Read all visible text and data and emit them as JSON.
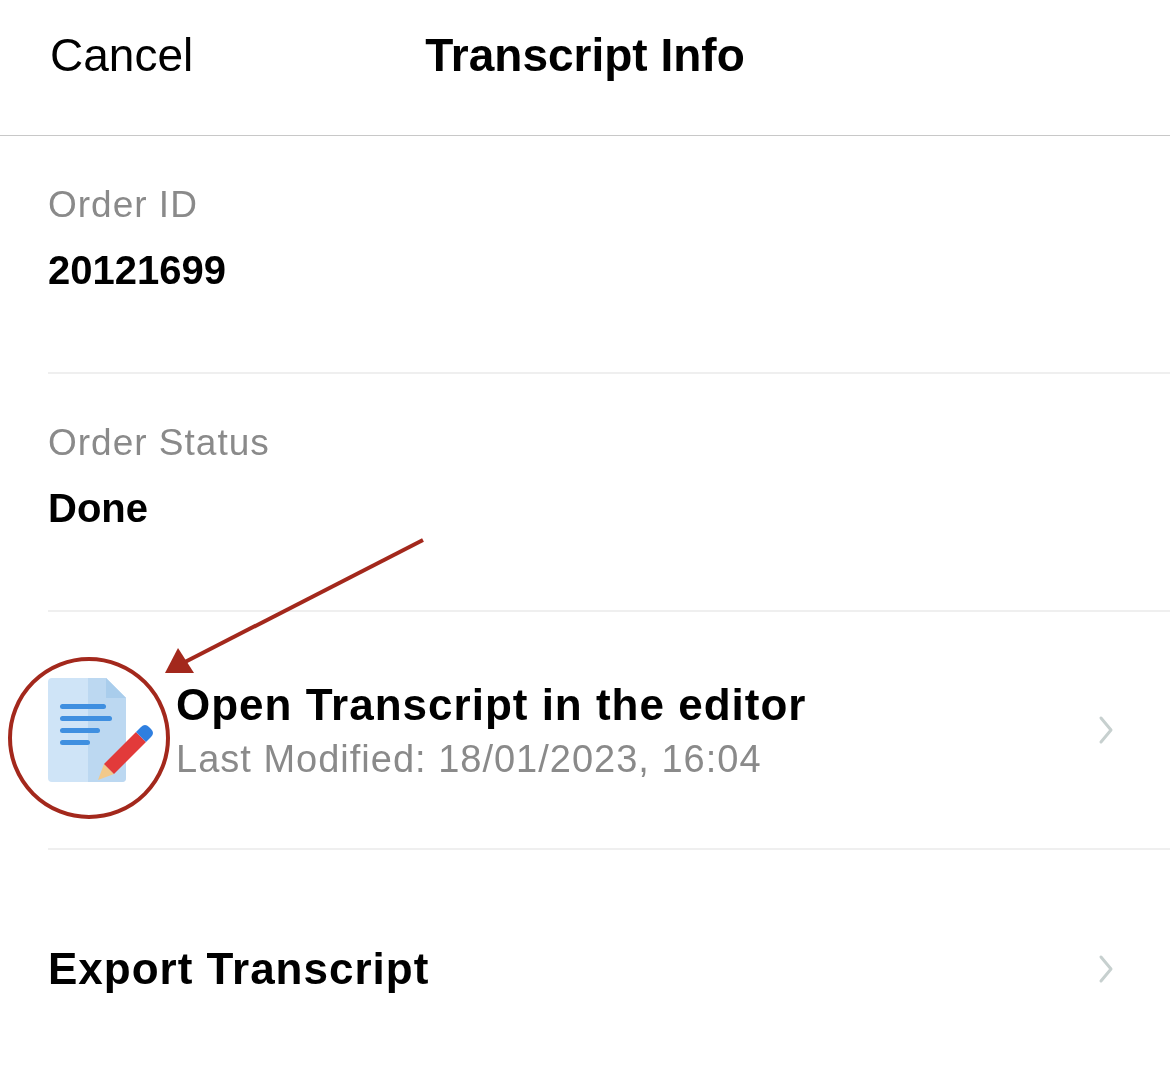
{
  "header": {
    "cancel": "Cancel",
    "title": "Transcript Info"
  },
  "rows": [
    {
      "kind": "field",
      "label": "Order ID",
      "value": "20121699"
    },
    {
      "kind": "field",
      "label": "Order Status",
      "value": "Done"
    },
    {
      "kind": "link",
      "title": "Open Transcript in the editor",
      "subtitle": "Last Modified: 18/01/2023, 16:04",
      "icon": true
    },
    {
      "kind": "link",
      "title": "Export Transcript"
    }
  ]
}
